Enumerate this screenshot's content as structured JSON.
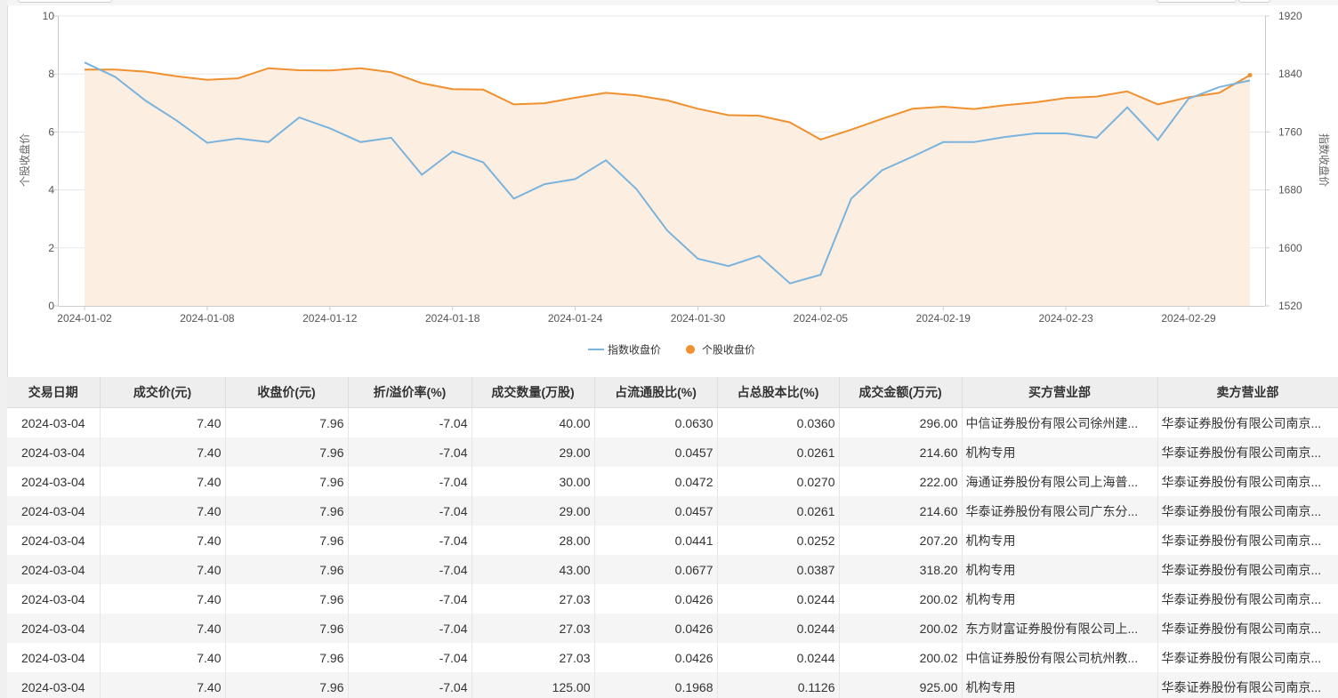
{
  "chart_data": {
    "type": "line",
    "x": [
      "2024-01-02",
      "2024-01-03",
      "2024-01-04",
      "2024-01-05",
      "2024-01-08",
      "2024-01-09",
      "2024-01-10",
      "2024-01-11",
      "2024-01-12",
      "2024-01-15",
      "2024-01-16",
      "2024-01-17",
      "2024-01-18",
      "2024-01-19",
      "2024-01-22",
      "2024-01-23",
      "2024-01-24",
      "2024-01-25",
      "2024-01-26",
      "2024-01-29",
      "2024-01-30",
      "2024-01-31",
      "2024-02-01",
      "2024-02-02",
      "2024-02-05",
      "2024-02-06",
      "2024-02-07",
      "2024-02-08",
      "2024-02-19",
      "2024-02-20",
      "2024-02-21",
      "2024-02-22",
      "2024-02-23",
      "2024-02-26",
      "2024-02-27",
      "2024-02-28",
      "2024-02-29",
      "2024-03-01",
      "2024-03-04"
    ],
    "x_tick_labels": [
      "2024-01-02",
      "2024-01-08",
      "2024-01-12",
      "2024-01-18",
      "2024-01-24",
      "2024-01-30",
      "2024-02-05",
      "2024-02-19",
      "2024-02-23",
      "2024-02-29"
    ],
    "y_left": {
      "label": "个股收盘价",
      "ticks": [
        "0",
        "2",
        "4",
        "6",
        "8",
        "10"
      ],
      "range": [
        0,
        10
      ]
    },
    "y_right": {
      "label": "指数收盘价",
      "ticks": [
        "1520",
        "1600",
        "1680",
        "1760",
        "1840",
        "1920"
      ],
      "range": [
        1520,
        1920
      ]
    },
    "series": [
      {
        "name": "指数收盘价",
        "axis": "right",
        "color": "#7ab3dc",
        "values": [
          1856,
          1836,
          1803,
          1776,
          1745,
          1751,
          1746,
          1780,
          1765,
          1746,
          1752,
          1701,
          1733,
          1718,
          1668,
          1688,
          1695,
          1721,
          1681,
          1624,
          1585,
          1575,
          1589,
          1551,
          1563,
          1668,
          1707,
          1726,
          1746,
          1746,
          1753,
          1758,
          1758,
          1752,
          1794,
          1749,
          1806,
          1822,
          1831
        ]
      },
      {
        "name": "个股收盘价",
        "axis": "left",
        "color": "#f0902e",
        "fill": "#fdeee2",
        "values": [
          8.15,
          8.15,
          8.08,
          7.92,
          7.8,
          7.85,
          8.2,
          8.13,
          8.12,
          8.2,
          8.06,
          7.68,
          7.48,
          7.46,
          6.95,
          6.99,
          7.18,
          7.35,
          7.26,
          7.09,
          6.8,
          6.58,
          6.56,
          6.33,
          5.74,
          6.08,
          6.45,
          6.8,
          6.87,
          6.79,
          6.92,
          7.02,
          7.17,
          7.22,
          7.4,
          6.95,
          7.2,
          7.35,
          7.96
        ]
      }
    ],
    "legend": {
      "placement": "bottom-center"
    },
    "grid": true
  },
  "table": {
    "headers": [
      "交易日期",
      "成交价(元)",
      "收盘价(元)",
      "折/溢价率(%)",
      "成交数量(万股)",
      "占流通股比(%)",
      "占总股本比(%)",
      "成交金额(万元)",
      "买方营业部",
      "卖方营业部"
    ],
    "rows": [
      [
        "2024-03-04",
        "7.40",
        "7.96",
        "-7.04",
        "40.00",
        "0.0630",
        "0.0360",
        "296.00",
        "中信证券股份有限公司徐州建...",
        "华泰证券股份有限公司南京..."
      ],
      [
        "2024-03-04",
        "7.40",
        "7.96",
        "-7.04",
        "29.00",
        "0.0457",
        "0.0261",
        "214.60",
        "机构专用",
        "华泰证券股份有限公司南京..."
      ],
      [
        "2024-03-04",
        "7.40",
        "7.96",
        "-7.04",
        "30.00",
        "0.0472",
        "0.0270",
        "222.00",
        "海通证券股份有限公司上海普...",
        "华泰证券股份有限公司南京..."
      ],
      [
        "2024-03-04",
        "7.40",
        "7.96",
        "-7.04",
        "29.00",
        "0.0457",
        "0.0261",
        "214.60",
        "华泰证券股份有限公司广东分...",
        "华泰证券股份有限公司南京..."
      ],
      [
        "2024-03-04",
        "7.40",
        "7.96",
        "-7.04",
        "28.00",
        "0.0441",
        "0.0252",
        "207.20",
        "机构专用",
        "华泰证券股份有限公司南京..."
      ],
      [
        "2024-03-04",
        "7.40",
        "7.96",
        "-7.04",
        "43.00",
        "0.0677",
        "0.0387",
        "318.20",
        "机构专用",
        "华泰证券股份有限公司南京..."
      ],
      [
        "2024-03-04",
        "7.40",
        "7.96",
        "-7.04",
        "27.03",
        "0.0426",
        "0.0244",
        "200.02",
        "机构专用",
        "华泰证券股份有限公司南京..."
      ],
      [
        "2024-03-04",
        "7.40",
        "7.96",
        "-7.04",
        "27.03",
        "0.0426",
        "0.0244",
        "200.02",
        "东方财富证券股份有限公司上...",
        "华泰证券股份有限公司南京..."
      ],
      [
        "2024-03-04",
        "7.40",
        "7.96",
        "-7.04",
        "27.03",
        "0.0426",
        "0.0244",
        "200.02",
        "中信证券股份有限公司杭州教...",
        "华泰证券股份有限公司南京..."
      ],
      [
        "2024-03-04",
        "7.40",
        "7.96",
        "-7.04",
        "125.00",
        "0.1968",
        "0.1126",
        "925.00",
        "机构专用",
        "华泰证券股份有限公司南京..."
      ]
    ]
  }
}
